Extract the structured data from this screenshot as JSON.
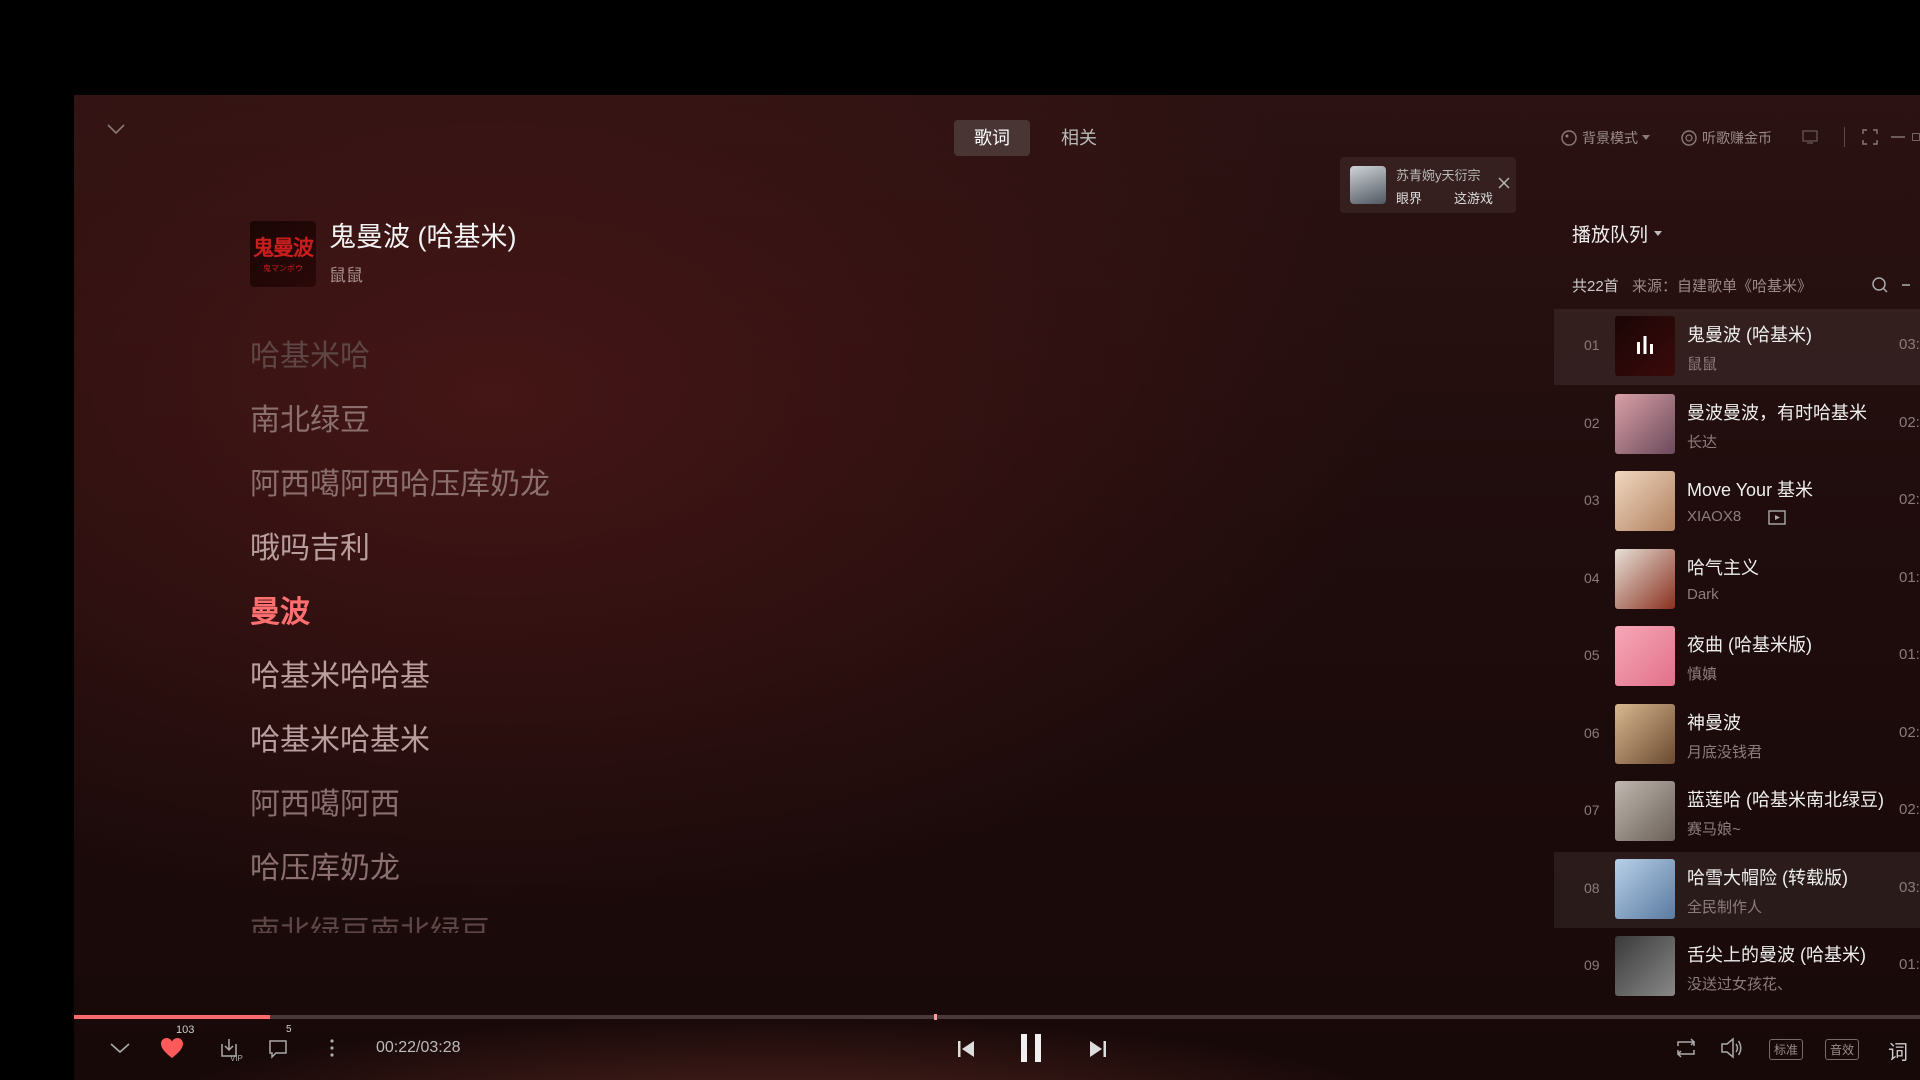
{
  "tabs": [
    {
      "label": "歌词",
      "active": true
    },
    {
      "label": "相关",
      "active": false
    }
  ],
  "header_actions": {
    "background_mode": "背景模式",
    "earn_coins": "听歌赚金币"
  },
  "notification": {
    "title": "苏青婉y天衍宗",
    "tag1": "眼界",
    "tag2": "这游戏"
  },
  "now_playing": {
    "title": "鬼曼波 (哈基米)",
    "artist": "鼠鼠",
    "cover_text": "鬼曼波",
    "cover_subtext": "鬼マンボウ"
  },
  "lyrics": [
    {
      "text": "哈基米哈",
      "state": "far"
    },
    {
      "text": "南北绿豆",
      "state": "past"
    },
    {
      "text": "阿西噶阿西哈压库奶龙",
      "state": "past"
    },
    {
      "text": "哦吗吉利",
      "state": "near"
    },
    {
      "text": "曼波",
      "state": "active"
    },
    {
      "text": "哈基米哈哈基",
      "state": "near"
    },
    {
      "text": "哈基米哈基米",
      "state": "near"
    },
    {
      "text": "阿西噶阿西",
      "state": "past"
    },
    {
      "text": "哈压库奶龙",
      "state": "past"
    },
    {
      "text": "南北绿豆南北绿豆",
      "state": "far"
    }
  ],
  "queue": {
    "title": "播放队列",
    "count": "共22首",
    "source": "来源：自建歌单《哈基米》",
    "items": [
      {
        "num": "01",
        "title": "鬼曼波 (哈基米)",
        "artist": "鼠鼠",
        "duration": "03:",
        "highlight": true,
        "cover_colors": [
          "#1a0606",
          "#3a0a0a"
        ]
      },
      {
        "num": "02",
        "title": "曼波曼波，有时哈基米",
        "artist": "长达",
        "duration": "02:",
        "highlight": false,
        "cover_colors": [
          "#d9a0a8",
          "#6a4a5a"
        ]
      },
      {
        "num": "03",
        "title": "Move Your 基米",
        "artist": "XIAOX8",
        "duration": "02:",
        "highlight": false,
        "cover_colors": [
          "#f0d8c0",
          "#b08060"
        ]
      },
      {
        "num": "04",
        "title": "哈气主义",
        "artist": "Dark",
        "duration": "01:",
        "highlight": false,
        "cover_colors": [
          "#e8e0d8",
          "#8a3020"
        ]
      },
      {
        "num": "05",
        "title": "夜曲 (哈基米版)",
        "artist": "慎嫃",
        "duration": "01:",
        "highlight": false,
        "cover_colors": [
          "#f7a8b8",
          "#e0708a"
        ]
      },
      {
        "num": "06",
        "title": "神曼波",
        "artist": "月底没钱君",
        "duration": "02:",
        "highlight": false,
        "cover_colors": [
          "#d8b890",
          "#6a4a30"
        ]
      },
      {
        "num": "07",
        "title": "蓝莲哈 (哈基米南北绿豆)",
        "artist": "赛马娘~",
        "duration": "02:",
        "highlight": false,
        "cover_colors": [
          "#c0b8b0",
          "#6a6058"
        ]
      },
      {
        "num": "08",
        "title": "哈雪大帽险 (转载版)",
        "artist": "全民制作人",
        "duration": "03:",
        "highlight": true,
        "cover_colors": [
          "#b8d0e8",
          "#5a7aa0"
        ]
      },
      {
        "num": "09",
        "title": "舌尖上的曼波 (哈基米)",
        "artist": "没送过女孩花、",
        "duration": "01:",
        "highlight": false,
        "cover_colors": [
          "#3a3a3a",
          "#888888"
        ]
      }
    ]
  },
  "player": {
    "time": "00:22/03:28",
    "progress": 0.106,
    "like_count": "103",
    "comment_count": "5",
    "vip_label": "VIP",
    "quality": "标准",
    "effects": "音效",
    "lyrics_btn": "词"
  },
  "colors": {
    "accent": "#ff6b6b",
    "highlight_row": "#3a2626"
  }
}
